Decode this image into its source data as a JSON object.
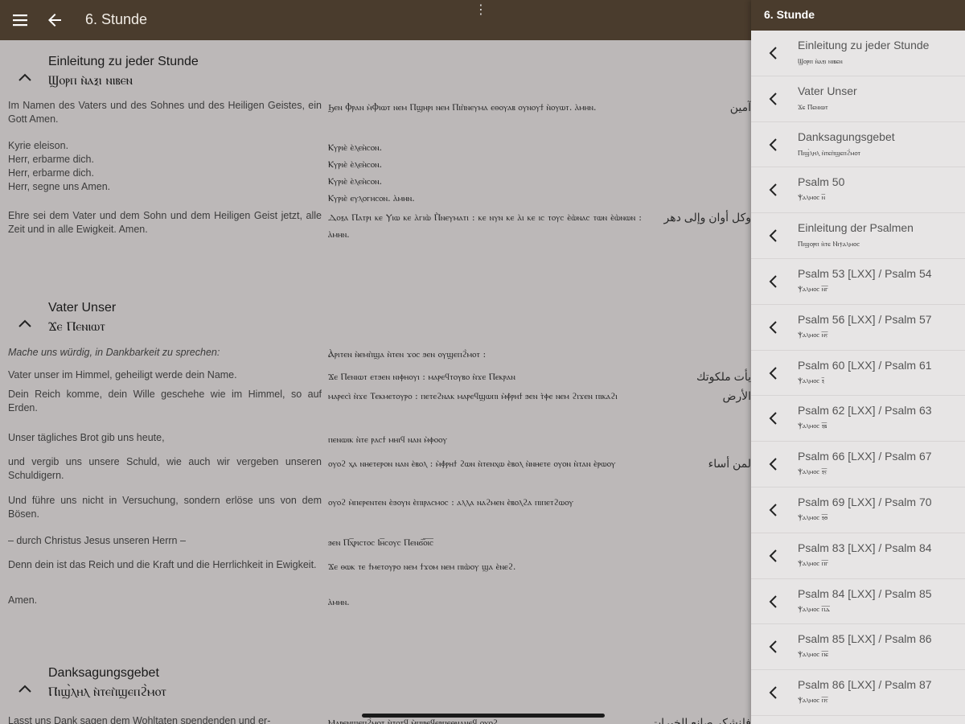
{
  "appbar": {
    "title": "6. Stunde",
    "overflow": "⋮"
  },
  "sections": [
    {
      "title": "Einleitung zu jeder Stunde",
      "coptic_title": "Ϣⲟⲣⲡ ⲛ̀ⲁⲝⲓ ⲛⲓⲃⲉⲛ",
      "rows": [
        {
          "de": "Im Namen des Vaters und des Sohnes und des Heiligen Geistes, ein Gott Amen.",
          "cop": "Ϧⲉⲛ Ⲫⲣⲁⲛ ⲙ̀Ⲫⲓⲱⲧ ⲛⲉⲙ Ⲡϣⲏⲣⲓ ⲛⲉⲙ Ⲡⲓⲡ̀ⲛⲉⲩⲙⲁ ⲉⲑⲟⲩⲁⲃ ⲟⲩⲛⲟⲩϯ ⲛ̀ⲟⲩⲱⲧ. ⲁ̀ⲙⲏⲛ.",
          "ar": "آمين"
        },
        {
          "de": "Kyrie eleison.\nHerr, erbarme dich.\nHerr, erbarme dich.\nHerr, segne uns Amen.",
          "cop": "Ⲕⲩⲣⲓⲉ̀ ⲉ̀ⲗⲉⲏ̀ⲥⲟⲛ.\nⲔⲩⲣⲓⲉ̀ ⲉ̀ⲗⲉⲏ̀ⲥⲟⲛ.\nⲔⲩⲣⲓⲉ̀ ⲉ̀ⲗⲉⲏ̀ⲥⲟⲛ.\nⲔⲩⲣⲓⲉ̀ ⲉⲩⲗⲟⲅⲏⲥⲟⲛ. ⲁ̀ⲙⲏⲛ.",
          "ar": ""
        },
        {
          "de": "Ehre sei dem Vater und dem Sohn und dem Heiligen Geist jetzt, alle Zeit und in alle Ewigkeit. Amen.",
          "cop": "Ⲇⲟⲝⲁ Ⲡⲁⲧⲣⲓ ⲕⲉ Ⲩⲓⲱ ⲕⲉ ⲁ̀ⲅⲓⲱ̀ Ⲡ̀ⲛⲉⲩⲙⲁⲧⲓ : ⲕⲉ ⲛⲩⲛ ⲕⲉ ⲁ̀ⲓ ⲕⲉ ⲓⲥ ⲧⲟⲩⲥ ⲉ̀ⲱ̀ⲛⲁⲥ ⲧⲱⲛ ⲉ̀ⲱ̀ⲛⲱⲛ : ⲁ̀ⲙⲏⲛ.",
          "ar": "وكل أوان وإلى دهر"
        }
      ]
    },
    {
      "title": "Vater Unser",
      "coptic_title": "Ϫⲉ Ⲡⲉⲛⲓⲱⲧ",
      "rows": [
        {
          "de": "Mache uns würdig, in Dankbarkeit zu sprechen:",
          "cop": "Ⲁ̀ⲣⲓⲧⲉⲛ ⲛ̀ⲉⲙⲡ̀ϣⲁ ⲛ̀ⲧⲉⲛ ϫⲟⲥ ϧⲉⲛ ⲟⲩϣⲉⲡϩ̀ⲙⲟⲧ :",
          "ar": ""
        },
        {
          "de": "Vater unser im Himmel, geheiligt werde dein Name.",
          "cop": "Ϫⲉ Ⲡⲉⲛⲓⲱⲧ ⲉⲧϧⲉⲛ ⲛⲓⲫⲏⲟⲩⲓ : ⲙⲁⲣⲉϥⲧⲟⲩⲃⲟ ⲛ̀ϫⲉ Ⲡⲉⲕⲣⲁⲛ",
          "ar": "يأت ملكوتك"
        },
        {
          "de": "Dein Reich komme, dein Wille geschehe wie im Himmel, so auf Erden.",
          "cop": "ⲙⲁⲣⲉⲥⲓ̀ ⲛ̀ϫⲉ Ⲧⲉⲕⲙⲉⲧⲟⲩⲣⲟ : ⲡⲉⲧⲉϩⲛⲁⲕ ⲙⲁⲣⲉϥϣⲱⲡⲓ ⲙ̀ⲫ̀ⲣⲏϯ ϧⲉⲛ ⲧ̀ⲫⲉ ⲛⲉⲙ ϩⲓϫⲉⲛ ⲡⲓⲕⲁϩⲓ",
          "ar": "الأرض"
        },
        {
          "de": "Unser tägliches Brot gib uns heute,",
          "cop": "ⲡⲉⲛⲱⲓⲕ ⲛ̀ⲧⲉ ⲣⲁⲥϯ ⲙⲏⲓϥ ⲛⲁⲛ ⲙ̀ⲫⲟⲟⲩ",
          "ar": ""
        },
        {
          "de": "und vergib uns unsere Schuld, wie auch wir vergeben unseren Schuldigern.",
          "cop": "ⲟⲩⲟϩ ⲭⲁ ⲛⲏⲉⲧⲉⲣⲟⲛ ⲛⲁⲛ ⲉ̀ⲃⲟⲗ : ⲙ̀ⲫ̀ⲣⲏϯ ϩⲱⲛ ⲛ̀ⲧⲉⲛⲭⲱ ⲉ̀ⲃⲟⲗ ⲛ̀ⲛⲏⲉⲧⲉ ⲟⲩⲟⲛ ⲛ̀ⲧⲁⲛ ⲉ̀ⲣⲱⲟⲩ",
          "ar": "لمن أساء إلينا"
        },
        {
          "de": "Und führe uns nicht in Versuchung, sondern erlöse uns von dem Bösen.",
          "cop": "ⲟⲩⲟϩ ⲙ̀ⲡⲉⲣⲉⲛⲧⲉⲛ ⲉ̀ϧⲟⲩⲛ ⲉ̀ⲡⲓⲣⲁⲥⲙⲟⲥ : ⲁⲗⲗⲁ ⲛⲁϩⲙⲉⲛ ⲉ̀ⲃⲟⲗϩⲁ ⲡⲓⲡⲉⲧϩⲱⲟⲩ",
          "ar": ""
        },
        {
          "de": "– durch Christus Jesus unseren Herrn –",
          "cop": "ϧⲉⲛ Ⲡⲭ̅ⲣⲓⲥⲧⲟⲥ Ⲓⲏ̅ⲥⲟⲩⲥ Ⲡⲉⲛϭ̅ⲟ̅ⲓ̅ⲥ̅",
          "ar": ""
        },
        {
          "de": "Denn dein ist das Reich und die Kraft und die Herrlichkeit in Ewigkeit.",
          "cop": "Ϫⲉ ⲑⲱⲕ ⲧⲉ ϯⲙⲉⲧⲟⲩⲣⲟ ⲛⲉⲙ ϯϫⲟⲙ ⲛⲉⲙ ⲡⲓⲱ̀ⲟⲩ ϣⲁ ⲉ̀ⲛⲉϩ.",
          "ar": ""
        },
        {
          "de": "Amen.",
          "cop": "ⲁ̀ⲙⲏⲛ.",
          "ar": ""
        }
      ]
    },
    {
      "title": "Danksagungsgebet",
      "coptic_title": "Ⲡⲓϣ̀ⲗⲏⲗ ⲛ̀ⲧⲉⲡ̀ϣⲉⲡϩ̀ⲙⲟⲧ",
      "rows": [
        {
          "de": "Lasst uns Dank sagen dem Wohltaten spendenden und er-",
          "cop": "Ⲙⲁⲣⲉⲛϣⲉⲡϩ̀ⲙⲟⲧ ⲛ̀ⲧⲟⲧϥ ⲙ̀ⲡⲓⲣⲉϥⲉⲣⲡⲉⲑⲛⲁⲛⲉϥ ⲟⲩⲟϩ",
          "ar": "فلنشكر صانع الخيرات"
        }
      ]
    }
  ],
  "drawer": {
    "title": "6. Stunde",
    "items": [
      {
        "label": "Einleitung zu jeder Stunde",
        "sub": "Ϣⲟⲣⲡ ⲛ̀ⲁⲝⲓ ⲛⲓⲃⲉⲛ"
      },
      {
        "label": "Vater Unser",
        "sub": "Ϫⲉ Ⲡⲉⲛⲓⲱⲧ"
      },
      {
        "label": "Danksagungsgebet",
        "sub": "Ⲡⲓϣ̀ⲗⲏⲗ ⲛ̀ⲧⲉⲡ̀ϣⲉⲡϩ̀ⲙⲟⲧ"
      },
      {
        "label": "Psalm 50",
        "sub": "Ⲯⲁⲗⲙⲟⲥ ⲛ̅"
      },
      {
        "label": "Einleitung der Psalmen",
        "sub": "Ⲡⲓϣⲟⲣⲡ ⲛ̀ⲧⲉ Ⲛⲓⲯⲁⲗⲙⲟⲥ"
      },
      {
        "label": "Psalm 53 [LXX] / Psalm 54",
        "sub": "Ⲯⲁⲗⲙⲟⲥ ⲛ̅ⲅ̅"
      },
      {
        "label": "Psalm 56 [LXX] / Psalm 57",
        "sub": "Ⲯⲁⲗⲙⲟⲥ ⲛ̅ⲋ̅"
      },
      {
        "label": "Psalm 60 [LXX] / Psalm 61",
        "sub": "Ⲯⲁⲗⲙⲟⲥ ⲝ̅"
      },
      {
        "label": "Psalm 62 [LXX] / Psalm 63",
        "sub": "Ⲯⲁⲗⲙⲟⲥ ⲝ̅ⲃ̅"
      },
      {
        "label": "Psalm 66 [LXX] / Psalm 67",
        "sub": "Ⲯⲁⲗⲙⲟⲥ ⲝ̅ⲋ̅"
      },
      {
        "label": "Psalm 69 [LXX] / Psalm 70",
        "sub": "Ⲯⲁⲗⲙⲟⲥ ⲝ̅ⲑ̅"
      },
      {
        "label": "Psalm 83 [LXX] / Psalm 84",
        "sub": "Ⲯⲁⲗⲙⲟⲥ ⲡ̅ⲅ̅"
      },
      {
        "label": "Psalm 84 [LXX] / Psalm 85",
        "sub": "Ⲯⲁⲗⲙⲟⲥ ⲡ̅ⲇ̅"
      },
      {
        "label": "Psalm 85 [LXX] / Psalm 86",
        "sub": "Ⲯⲁⲗⲙⲟⲥ ⲡ̅ⲉ̅"
      },
      {
        "label": "Psalm 86 [LXX] / Psalm 87",
        "sub": "Ⲯⲁⲗⲙⲟⲥ ⲡ̅ⲋ̅"
      }
    ]
  },
  "colors": {
    "appbar": "#4a3c2d",
    "content_bg": "#bcb8b8",
    "drawer_bg": "#e7e5e5"
  }
}
